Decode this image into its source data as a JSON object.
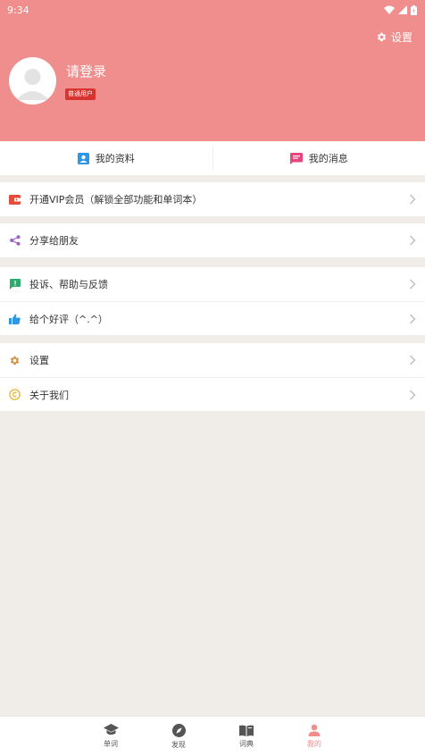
{
  "status_bar": {
    "time": "9:34"
  },
  "header": {
    "settings_label": "设置",
    "login_text": "请登录",
    "user_badge": "普通用户"
  },
  "quick_actions": [
    {
      "label": "我的资料",
      "icon": "contact-card-icon"
    },
    {
      "label": "我的消息",
      "icon": "message-icon"
    }
  ],
  "menu": {
    "vip": "开通VIP会员（解锁全部功能和单词本）",
    "share": "分享给朋友",
    "feedback": "投诉、帮助与反馈",
    "rate": "给个好评（^.^）",
    "settings": "设置",
    "about": "关于我们"
  },
  "tabs": [
    {
      "label": "单词",
      "icon": "graduation-cap-icon"
    },
    {
      "label": "发现",
      "icon": "compass-icon"
    },
    {
      "label": "词典",
      "icon": "book-icon"
    },
    {
      "label": "我的",
      "icon": "person-icon",
      "active": true
    }
  ],
  "colors": {
    "header_bg": "#f08e8e",
    "accent": "#f08e8e",
    "badge": "#d7332f",
    "page_bg": "#f0ede8"
  }
}
